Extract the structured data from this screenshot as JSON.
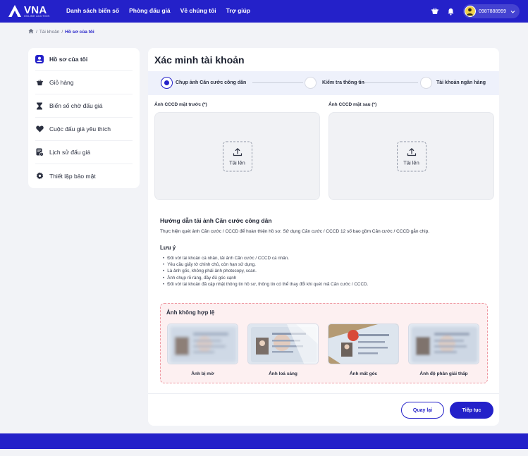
{
  "header": {
    "logo_text": "VNA",
    "logo_sub": "ONLINE AUCTION",
    "nav": [
      "Danh sách biển số",
      "Phòng đấu giá",
      "Về chúng tôi",
      "Trợ giúp"
    ],
    "phone": "0987888999",
    "icons": [
      "cart-icon",
      "bell-icon",
      "avatar",
      "chevron-down-icon"
    ]
  },
  "breadcrumb": {
    "items": [
      "Tài khoản",
      "Hồ sơ của tôi"
    ]
  },
  "sidebar": {
    "items": [
      {
        "label": "Hồ sơ của tôi",
        "icon": "user-icon"
      },
      {
        "label": "Giỏ hàng",
        "icon": "cart-icon"
      },
      {
        "label": "Biển số chờ đấu giá",
        "icon": "hourglass-icon"
      },
      {
        "label": "Cuộc đấu giá yêu thích",
        "icon": "heart-icon"
      },
      {
        "label": "Lịch sử đấu giá",
        "icon": "history-icon"
      },
      {
        "label": "Thiết lập bảo mật",
        "icon": "gear-icon"
      }
    ]
  },
  "main": {
    "title": "Xác minh tài khoản",
    "steps": [
      {
        "label": "Chụp ảnh Căn cước công dân",
        "active": true
      },
      {
        "label": "Kiểm tra thông tin",
        "active": false
      },
      {
        "label": "Tài khoản ngân hàng",
        "active": false
      }
    ],
    "front_label": "Ảnh CCCD mặt trước (*)",
    "back_label": "Ảnh CCCD mặt sau (*)",
    "upload_label": "Tải lên",
    "guide_title": "Hướng dẫn tải ảnh Căn cước công dân",
    "guide_desc": "Thực hiện quét ảnh Căn cước / CCCD để hoàn thiện hồ sơ. Sử dụng Căn cước / CCCD 12 số bao gồm Căn cước / CCCD gắn chip.",
    "note_title": "Lưu ý",
    "notes": [
      "Đối với tài khoản cá nhân, tải ảnh Căn cước / CCCD cá nhân.",
      "Yêu cầu giấy tờ chính chủ, còn hạn sử dụng.",
      "Là ảnh gốc, không phải ảnh photocopy, scan.",
      "Ảnh chụp rõ ràng, đầy đủ góc cạnh",
      "Đối với tài khoản đã cập nhật thông tin hồ sơ, thông tin có thể thay đổi khi quét mã Căn cước / CCCD."
    ],
    "invalid_title": "Ảnh không hợp lệ",
    "invalid_examples": [
      "Ảnh bị mờ",
      "Ảnh loá sáng",
      "Ảnh mất góc",
      "Ảnh độ phân giải thấp"
    ],
    "back_button": "Quay lại",
    "next_button": "Tiếp tục"
  },
  "colors": {
    "primary": "#2421c9",
    "bg": "#f2f3f7",
    "invalid_bg": "#fdf0f1",
    "invalid_border": "#ef9aa3"
  }
}
